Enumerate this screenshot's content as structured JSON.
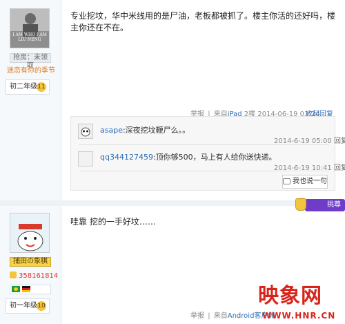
{
  "post1": {
    "avatar_caption": "I AM WHO I AM LIU NENG",
    "medal_label": "抢房：未领取",
    "member_title": "迷恋有你的季节",
    "level_name": "初二年级",
    "level_num": "11",
    "content": "专业挖坟，华中米线用的是尸油，老板都被抓了。楼主你活的还好吗，楼主你还在不在。",
    "report": "举报",
    "source_prefix": "来自",
    "source": "iPad",
    "floor": "2楼",
    "time": "2014-06-19 03:24",
    "collapse": "收起回复",
    "replies": [
      {
        "user": "asape",
        "text": ":深夜挖坟鞭尸么。。",
        "time": "2014-6-19 05:00",
        "action": "回复"
      },
      {
        "user": "qq344127459",
        "text": ":顶你够500，马上有人给你送快递。",
        "time": "2014-6-19 10:41",
        "action": "回复"
      }
    ],
    "say_button": "我也说一句"
  },
  "post2": {
    "vip_tag": "挑尊",
    "member_title": "捕田の象棋",
    "points": "358161814",
    "level_name": "初一年级",
    "level_num": "10",
    "content": "哇靠 挖的一手好坟……",
    "report": "举报",
    "source_prefix": "来自",
    "source": "Android客户端"
  },
  "watermark": {
    "brand": "映象网",
    "url": "WWW.HNR.CN"
  },
  "colors": {
    "link": "#2a6bb6",
    "meta": "#8a8a8a",
    "gold": "#f3c53f",
    "vip": "#6f3bc9",
    "watermark": "#d9241b"
  }
}
